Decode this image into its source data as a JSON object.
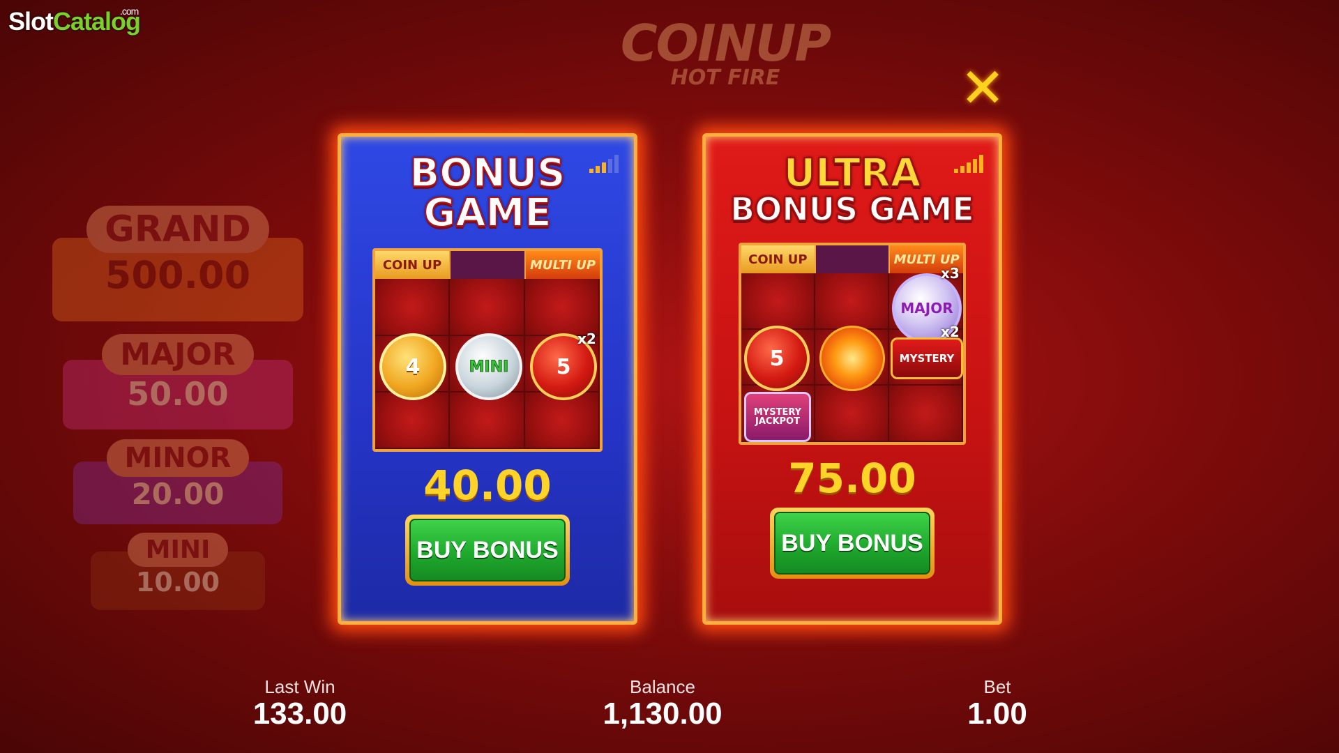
{
  "watermark": {
    "part1": "Slot",
    "part2": "Catalog",
    "suffix": ".com"
  },
  "game_logo": {
    "line1": "COINUP",
    "line2": "HOT FIRE"
  },
  "close": {
    "symbol": "✕"
  },
  "jackpots": [
    {
      "name": "GRAND",
      "value": "500.00"
    },
    {
      "name": "MAJOR",
      "value": "50.00"
    },
    {
      "name": "MINOR",
      "value": "20.00"
    },
    {
      "name": "MINI",
      "value": "10.00"
    }
  ],
  "bonus_game": {
    "title_line1": "BONUS",
    "title_line2": "GAME",
    "grid_header": [
      "COIN UP",
      "",
      "MULTI UP"
    ],
    "coins": {
      "gold": "4",
      "silver": "MINI",
      "red": "5",
      "multiplier": "x2"
    },
    "price": "40.00",
    "button_label": "BUY BONUS",
    "colors": {
      "bg": "#2f48e4"
    }
  },
  "ultra_bonus_game": {
    "title_line1": "ULTRA",
    "title_line2": "BONUS GAME",
    "grid_header": [
      "COIN UP",
      "",
      "MULTI UP"
    ],
    "coins": {
      "red": "5",
      "major": "MAJOR",
      "mystery": "MYSTERY",
      "mystery_jackpot": "MYSTERY JACKPOT",
      "mult_major": "x3",
      "mult_mystery": "x2"
    },
    "price": "75.00",
    "button_label": "BUY BONUS",
    "colors": {
      "bg": "#e01a18"
    }
  },
  "footer": {
    "last_win_label": "Last Win",
    "last_win": "133.00",
    "balance_label": "Balance",
    "balance": "1,130.00",
    "bet_label": "Bet",
    "bet": "1.00"
  }
}
